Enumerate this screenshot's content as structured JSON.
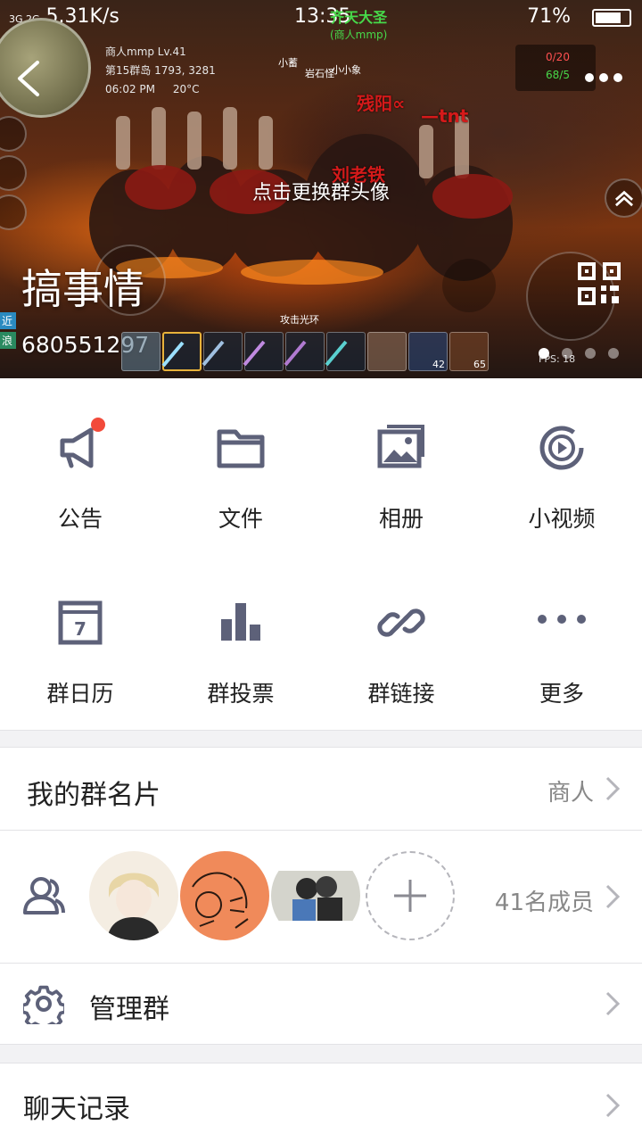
{
  "status_bar": {
    "signal": "3G 2G",
    "speed": "5.31K/s",
    "time": "13:35",
    "battery": "71%"
  },
  "banner": {
    "player_name": "商人mmp Lv.41",
    "player_location": "第15群岛 1793, 3281",
    "player_time": "06:02 PM",
    "player_temp": "20°C",
    "hud_top": "0/20",
    "hud_bottom": "68/5",
    "top_center_label": "齐天大圣",
    "top_center_sub": "(商人mmp)",
    "overlay_hint": "点击更换群头像",
    "group_name": "搞事情",
    "group_id": "680551297",
    "attack_label": "攻击光环",
    "fps": "FPS: 18",
    "slot_counts": [
      "42",
      "65"
    ],
    "tags": [
      "近",
      "浪"
    ],
    "red_names": [
      "残阳∝",
      "—tnt",
      "刘老铁"
    ],
    "npc_names": [
      "小蓄",
      "岩石怪",
      "小小象"
    ]
  },
  "grid": {
    "items": [
      {
        "label": "公告",
        "icon": "megaphone-icon",
        "badge": true
      },
      {
        "label": "文件",
        "icon": "folder-icon"
      },
      {
        "label": "相册",
        "icon": "photo-album-icon"
      },
      {
        "label": "小视频",
        "icon": "video-play-icon"
      },
      {
        "label": "群日历",
        "icon": "calendar-icon",
        "calendar_day": "7"
      },
      {
        "label": "群投票",
        "icon": "bar-chart-icon"
      },
      {
        "label": "群链接",
        "icon": "link-icon"
      },
      {
        "label": "更多",
        "icon": "more-dots-icon"
      }
    ]
  },
  "card": {
    "title": "我的群名片",
    "value": "商人"
  },
  "members": {
    "count_label": "41名成员"
  },
  "manage": {
    "title": "管理群"
  },
  "chat": {
    "title": "聊天记录"
  },
  "colors": {
    "icon_color": "#5d6179",
    "badge_red": "#f24a3a",
    "text_main": "#222222",
    "text_secondary": "#888888"
  }
}
